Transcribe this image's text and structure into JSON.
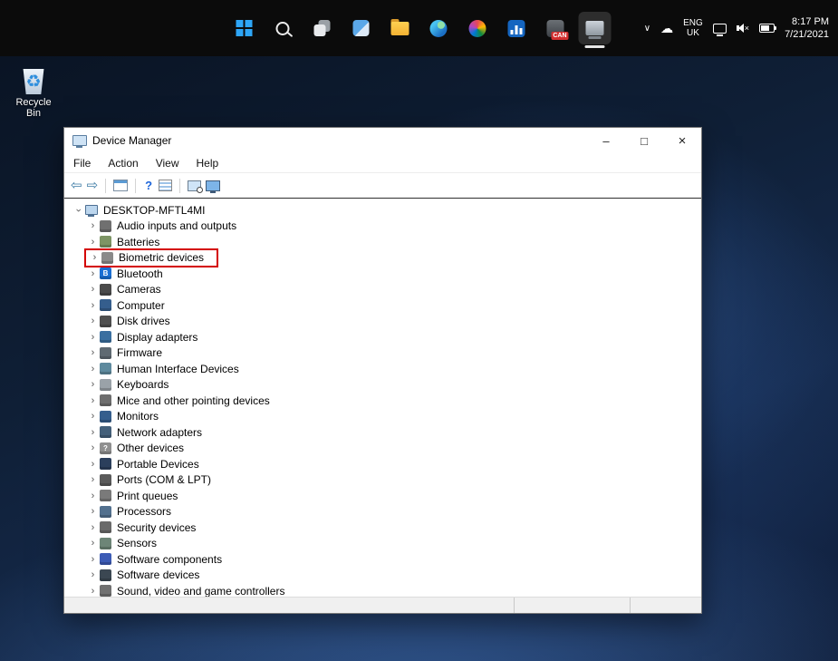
{
  "taskbar": {
    "icons": [
      "start-button",
      "search",
      "task-view",
      "widgets",
      "file-explorer",
      "edge",
      "photos",
      "task-manager",
      "can-app",
      "device-manager-active"
    ],
    "can_badge": "CAN",
    "tray": {
      "chevron": "∨",
      "lang_top": "ENG",
      "lang_bottom": "UK",
      "time": "8:17 PM",
      "date": "7/21/2021"
    }
  },
  "desktop": {
    "recycle_bin_label": "Recycle Bin",
    "recycle_symbol": "♻"
  },
  "device_manager": {
    "title": "Device Manager",
    "controls": {
      "minimize": "–",
      "maximize": "□",
      "close": "×"
    },
    "menu": [
      "File",
      "Action",
      "View",
      "Help"
    ],
    "toolbar": {
      "back": "⇦",
      "forward": "⇨",
      "help": "?"
    },
    "tree": {
      "root": {
        "label": "DESKTOP-MFTL4MI"
      },
      "items": [
        {
          "label": "Audio inputs and outputs",
          "icon": "speaker-icon",
          "color": "#707070"
        },
        {
          "label": "Batteries",
          "icon": "battery-icon",
          "color": "#7d9464"
        },
        {
          "label": "Biometric devices",
          "icon": "fingerprint-icon",
          "color": "#8a8a8a",
          "highlighted": true
        },
        {
          "label": "Bluetooth",
          "icon": "bluetooth-icon",
          "color": "#1a6fd4",
          "glyph": "B"
        },
        {
          "label": "Cameras",
          "icon": "camera-icon",
          "color": "#4a4a4a"
        },
        {
          "label": "Computer",
          "icon": "computer-icon",
          "color": "#355e8d"
        },
        {
          "label": "Disk drives",
          "icon": "disk-icon",
          "color": "#4f4f4f"
        },
        {
          "label": "Display adapters",
          "icon": "display-adapter-icon",
          "color": "#3a6fa0"
        },
        {
          "label": "Firmware",
          "icon": "firmware-chip-icon",
          "color": "#5f6a72"
        },
        {
          "label": "Human Interface Devices",
          "icon": "hid-icon",
          "color": "#5e8a9e"
        },
        {
          "label": "Keyboards",
          "icon": "keyboard-icon",
          "color": "#9aa2a8"
        },
        {
          "label": "Mice and other pointing devices",
          "icon": "mouse-icon",
          "color": "#6e6e6e"
        },
        {
          "label": "Monitors",
          "icon": "monitor-icon",
          "color": "#355e8d"
        },
        {
          "label": "Network adapters",
          "icon": "network-icon",
          "color": "#44607a"
        },
        {
          "label": "Other devices",
          "icon": "unknown-device-icon",
          "color": "#909090",
          "glyph": "?"
        },
        {
          "label": "Portable Devices",
          "icon": "portable-device-icon",
          "color": "#2b3f5c"
        },
        {
          "label": "Ports (COM & LPT)",
          "icon": "port-icon",
          "color": "#5a5a5a"
        },
        {
          "label": "Print queues",
          "icon": "printer-icon",
          "color": "#7a7a7a"
        },
        {
          "label": "Processors",
          "icon": "cpu-icon",
          "color": "#52708e"
        },
        {
          "label": "Security devices",
          "icon": "security-icon",
          "color": "#6b6b6b"
        },
        {
          "label": "Sensors",
          "icon": "sensor-icon",
          "color": "#6d8577"
        },
        {
          "label": "Software components",
          "icon": "software-component-icon",
          "color": "#3c5bb5"
        },
        {
          "label": "Software devices",
          "icon": "software-device-icon",
          "color": "#3b4752"
        },
        {
          "label": "Sound, video and game controllers",
          "icon": "sound-icon",
          "color": "#707070"
        }
      ]
    }
  }
}
